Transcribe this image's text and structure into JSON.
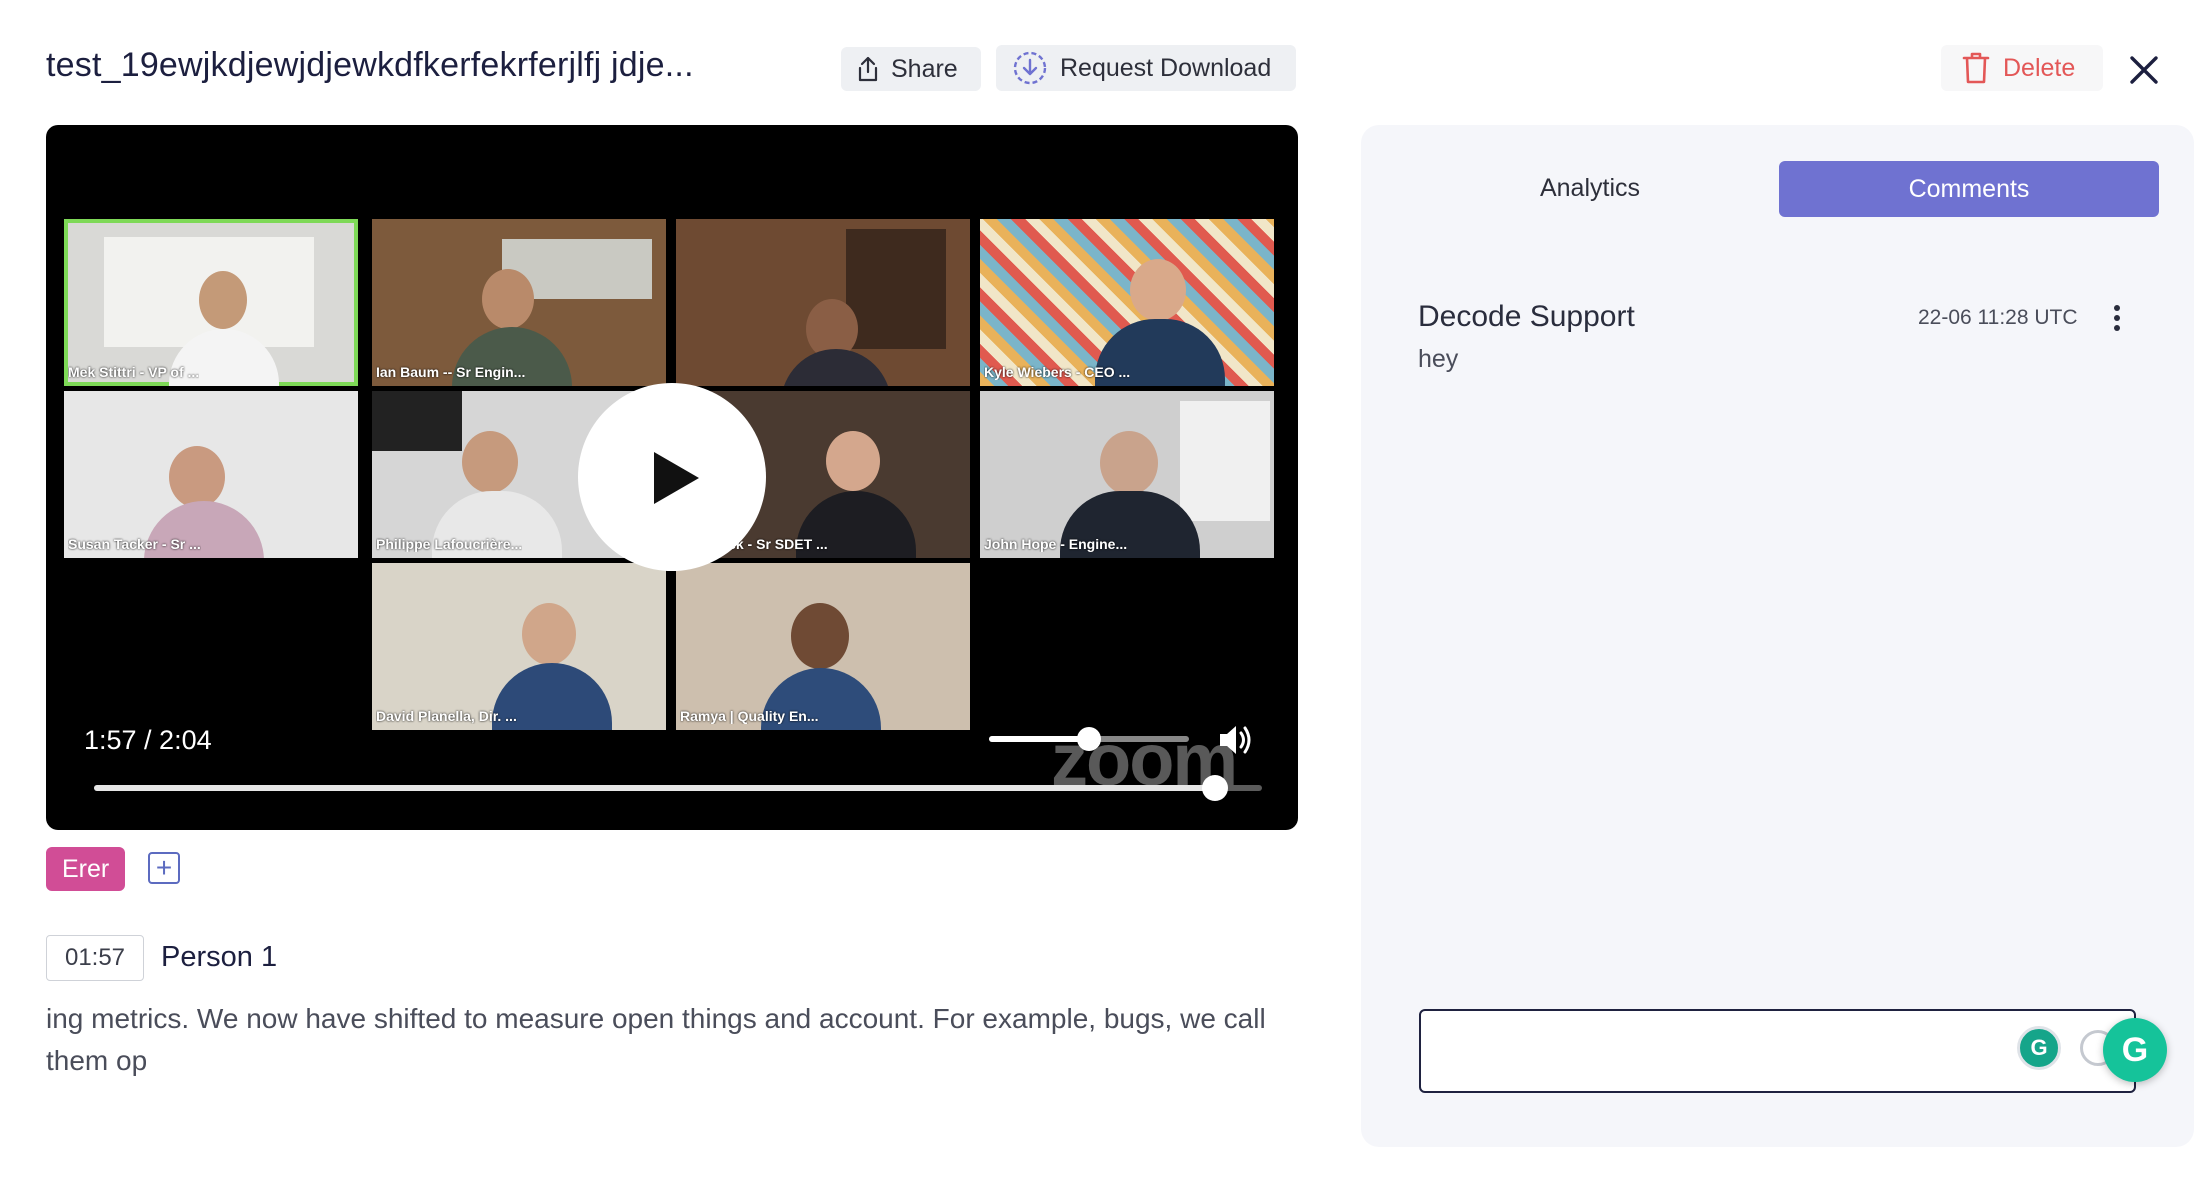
{
  "header": {
    "title": "test_19ewjkdjewjdjewkdfkerfekrferjlfj jdje...",
    "share_label": "Share",
    "request_download_label": "Request Download",
    "delete_label": "Delete"
  },
  "player": {
    "time_display": "1:57 / 2:04",
    "progress_fraction": 0.96,
    "volume_fraction": 0.5,
    "watermark": "zoom",
    "participants": [
      {
        "name": "Mek Stittri - VP of ...",
        "active": true
      },
      {
        "name": "Ian Baum -- Sr Engin...",
        "active": false
      },
      {
        "name": "",
        "active": false
      },
      {
        "name": "Kyle Wiebers - CEO ...",
        "active": false
      },
      {
        "name": "Susan Tacker - Sr ...",
        "active": false
      },
      {
        "name": "Philippe Lafoucrière...",
        "active": false
      },
      {
        "name": "Will Meek - Sr SDET ...",
        "active": false
      },
      {
        "name": "John Hope - Engine...",
        "active": false
      },
      {
        "name": "David Planella, Dir. ...",
        "active": false
      },
      {
        "name": "Ramya | Quality En...",
        "active": false
      }
    ]
  },
  "tags": {
    "items": [
      "Erer"
    ],
    "add_label": "+"
  },
  "transcript": {
    "timestamp": "01:57",
    "speaker": "Person 1",
    "text": "ing metrics. We now have shifted to measure open things and account. For example, bugs, we call them op"
  },
  "side_panel": {
    "tabs": [
      {
        "label": "Analytics",
        "active": false
      },
      {
        "label": "Comments",
        "active": true
      }
    ],
    "comments": [
      {
        "author": "Decode Support",
        "time": "22-06 11:28 UTC",
        "text": "hey"
      }
    ],
    "input": {
      "value": "",
      "placeholder": ""
    }
  },
  "colors": {
    "accent": "#6f72d1",
    "tag": "#d14d96",
    "delete": "#e35757",
    "active_speaker": "#7ed957",
    "grammarly": "#15c39a"
  }
}
